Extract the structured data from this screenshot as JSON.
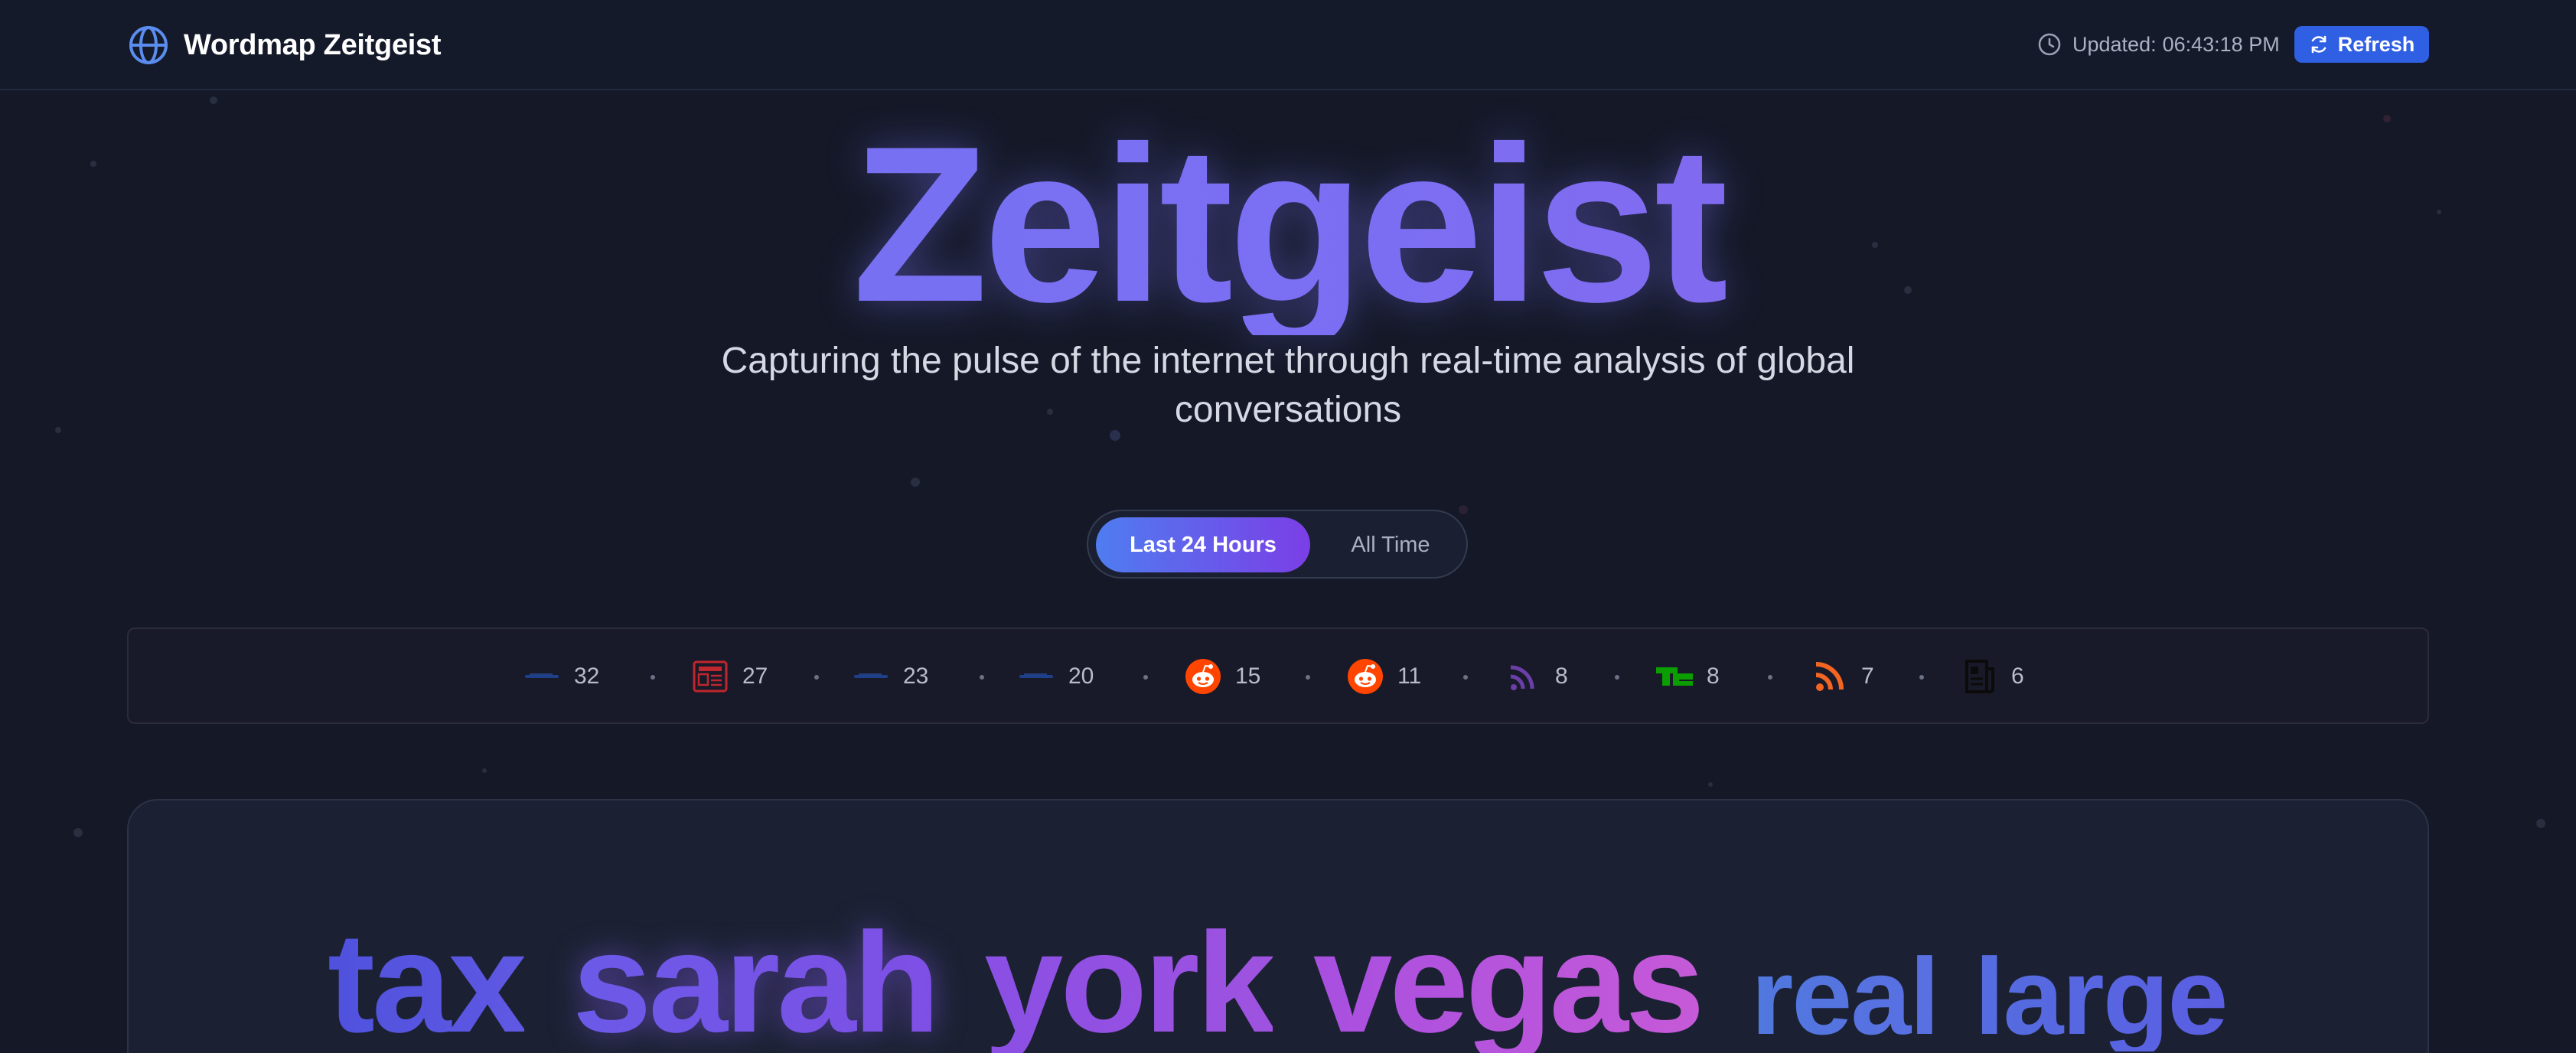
{
  "header": {
    "app_title": "Wordmap Zeitgeist",
    "brand_icon": "globe-icon",
    "updated_label": "Updated:",
    "updated_time": "06:43:18 PM",
    "clock_icon": "clock-icon",
    "refresh_label": "Refresh",
    "refresh_icon": "refresh-icon",
    "accent_color": "#2f5fe3"
  },
  "hero": {
    "title": "Zeitgeist",
    "subtitle": "Capturing the pulse of the internet through real-time analysis of global conversations"
  },
  "time_range": {
    "options": [
      "Last 24 Hours",
      "All Time"
    ],
    "selected": "Last 24 Hours"
  },
  "sources": [
    {
      "icon": "news-logo-icon",
      "count": "32"
    },
    {
      "icon": "newspaper-icon",
      "count": "27"
    },
    {
      "icon": "news-logo-icon",
      "count": "23"
    },
    {
      "icon": "news-logo-icon",
      "count": "20"
    },
    {
      "icon": "reddit-icon",
      "count": "15"
    },
    {
      "icon": "reddit-icon",
      "count": "11"
    },
    {
      "icon": "rss-icon",
      "count": "8"
    },
    {
      "icon": "techcrunch-icon",
      "count": "8"
    },
    {
      "icon": "rss-icon",
      "count": "7"
    },
    {
      "icon": "document-icon",
      "count": "6"
    }
  ],
  "wordmap": {
    "words": [
      {
        "text": "tax",
        "color": "#5a56e0"
      },
      {
        "text": "sarah",
        "color": "#7b52e6"
      },
      {
        "text": "york",
        "color": "#9a4fe2"
      },
      {
        "text": "vegas",
        "color": "#b553dd"
      },
      {
        "text": "real",
        "color": "#5b78e2"
      },
      {
        "text": "large",
        "color": "#5b68e2"
      }
    ]
  }
}
